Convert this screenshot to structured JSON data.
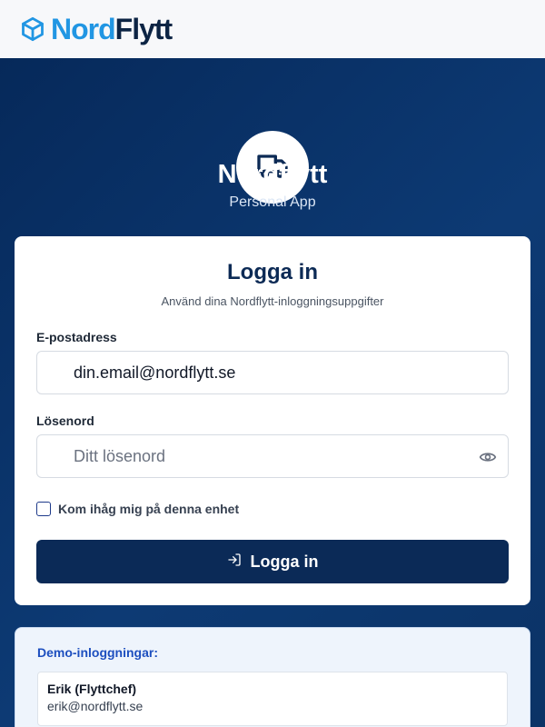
{
  "header": {
    "logo_icon": "box-icon",
    "logo_nord": "Nord",
    "logo_flytt": "Flytt",
    "colors": {
      "nord": "#2196e3",
      "flytt": "#0c2444"
    }
  },
  "hero": {
    "avatar_icon": "truck-icon",
    "title": "Nordflytt",
    "subtitle": "Personal App"
  },
  "login_card": {
    "title": "Logga in",
    "subtitle": "Använd dina Nordflytt-inloggningsuppgifter",
    "email": {
      "label": "E-postadress",
      "value": "din.email@nordflytt.se",
      "placeholder": "din.email@nordflytt.se"
    },
    "password": {
      "label": "Lösenord",
      "value": "",
      "placeholder": "Ditt lösenord",
      "toggle_icon": "eye-icon"
    },
    "remember_label": "Kom ihåg mig på denna enhet",
    "remember_checked": false,
    "submit_label": "Logga in",
    "submit_icon": "login-icon",
    "accent": "#0b2a57"
  },
  "demo": {
    "title": "Demo-inloggningar:",
    "items": [
      {
        "name": "Erik (Flyttchef)",
        "email": "erik@nordflytt.se"
      }
    ]
  }
}
